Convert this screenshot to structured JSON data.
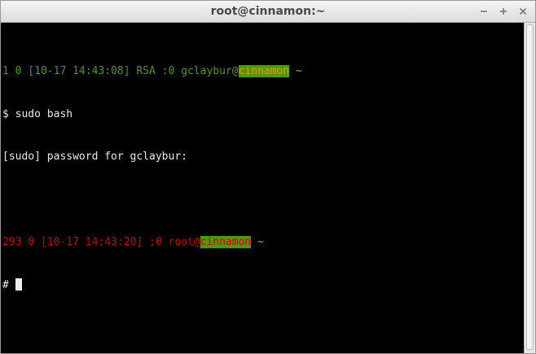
{
  "window": {
    "title": "root@cinnamon:~",
    "controls": {
      "minimize": "−",
      "maximize": "+",
      "close": "×"
    }
  },
  "terminal": {
    "line1": {
      "prefix": "1 0 [10-17 14:43:08] RSA :0 gclaybur@",
      "host": "cinnamon",
      "suffix": " ~"
    },
    "line2": "$ sudo bash",
    "line3": "[sudo] password for gclaybur:",
    "line5": {
      "prefix": "293 0 [10-17 14:43:20] :0 root@",
      "host": "cinnamon",
      "suffix": " ~"
    },
    "line6": "#"
  },
  "colors": {
    "background": "#000000",
    "user_prompt": "#4e9a06",
    "root_prompt": "#cc0000",
    "host_highlight": "#4e9a06",
    "tilde": "#d9a100",
    "text": "#e8e8e8"
  }
}
